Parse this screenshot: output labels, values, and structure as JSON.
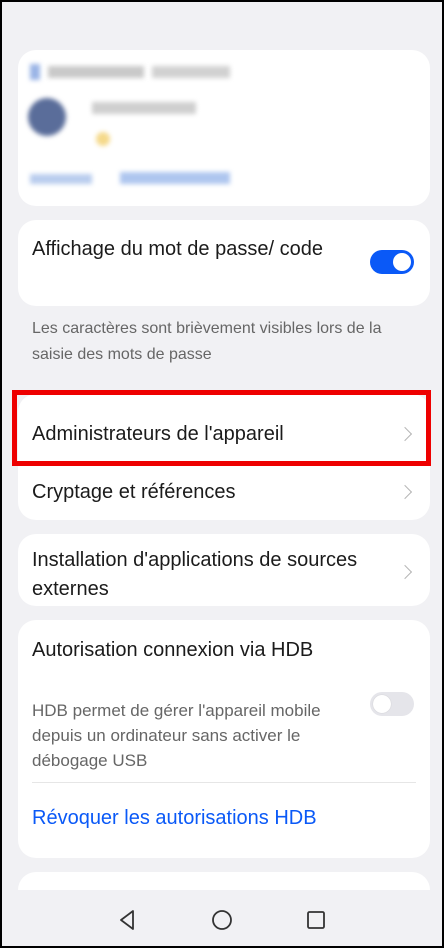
{
  "password_display": {
    "label": "Affichage du mot de passe/ code",
    "enabled": true,
    "description": "Les caractères sont brièvement visibles lors de la saisie des mots de passe"
  },
  "menu": {
    "device_admins": "Administrateurs de l'appareil",
    "encryption": "Cryptage et références",
    "external_install": "Installation d'applications de sources externes"
  },
  "hdb": {
    "label": "Autorisation connexion via HDB",
    "enabled": false,
    "description": "HDB permet de gérer l'appareil mobile depuis un ordinateur sans activer le débogage USB",
    "revoke_link": "Révoquer les autorisations HDB"
  },
  "nav": {
    "back_icon": "back-triangle-icon",
    "home_icon": "home-circle-icon",
    "recent_icon": "recent-square-icon"
  },
  "colors": {
    "accent": "#0a59f7",
    "highlight": "#ee0000"
  }
}
